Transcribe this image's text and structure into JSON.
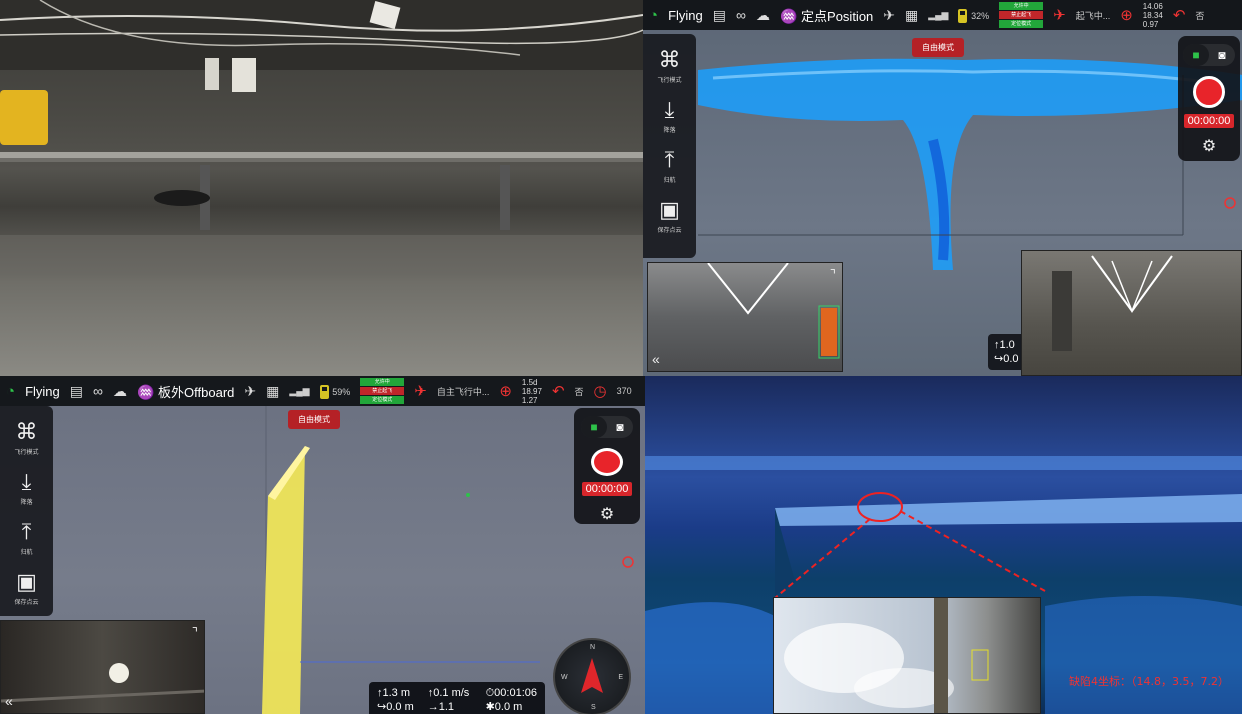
{
  "q2": {
    "status": {
      "flight_state": "Flying",
      "mode_label": "定点Position",
      "stack_labels": [
        "允许中",
        "禁止起飞",
        "定位模式"
      ],
      "takeoff_label": "起飞中...",
      "tele": [
        "14.06",
        "18.34",
        "0.97"
      ],
      "return_label": "否",
      "battery_label": "32%"
    },
    "side_tools": [
      {
        "icon": "⌘",
        "label": "飞行模式"
      },
      {
        "icon": "⤓",
        "label": "降落"
      },
      {
        "icon": "⤒",
        "label": "归航"
      },
      {
        "icon": "▣",
        "label": "保存点云"
      }
    ],
    "mode_button": "自由模式",
    "timer": "00:00:00",
    "readout": [
      "↑1.0",
      "↪0.0"
    ]
  },
  "q3": {
    "status": {
      "flight_state": "Flying",
      "mode_label": "板外Offboard",
      "battery": "59%",
      "stack_labels": [
        "允许中",
        "禁止起飞",
        "定位模式"
      ],
      "takeoff_label": "自主飞行中...",
      "tele": [
        "1.5d",
        "18.97",
        "1.27"
      ],
      "return_label": "否",
      "extra": "370"
    },
    "side_tools": [
      {
        "icon": "⌘",
        "label": "飞行模式"
      },
      {
        "icon": "⤓",
        "label": "降落"
      },
      {
        "icon": "⤒",
        "label": "归航"
      },
      {
        "icon": "▣",
        "label": "保存点云"
      }
    ],
    "mode_button": "自由模式",
    "timer": "00:00:00",
    "info": [
      "↑1.3 m",
      "↑0.1 m/s",
      "⏱00:01:06",
      "↪0.0 m",
      "→1.1 m/s",
      "✱0.0 m"
    ],
    "compass": {
      "n": "N",
      "e": "E",
      "s": "S",
      "w": "W"
    }
  },
  "q4": {
    "defect_label": "缺陷4坐标：（14.8，3.5，7.2）"
  }
}
